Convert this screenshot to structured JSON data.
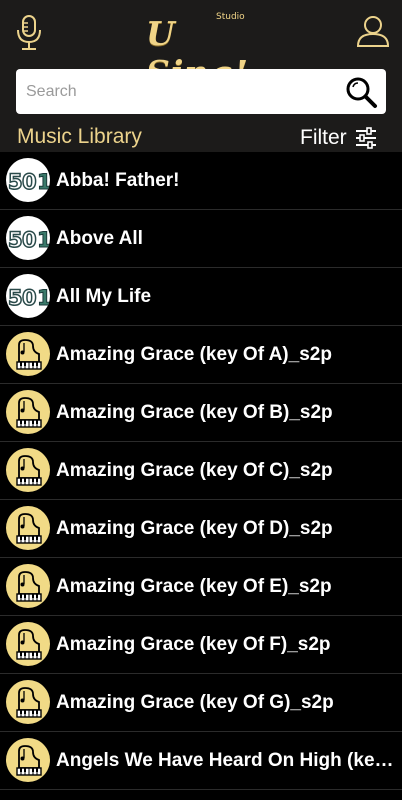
{
  "header": {
    "logo_text": "U Sing!",
    "logo_sub": "Studio",
    "colors": {
      "accent": "#ecd38c",
      "bar": "#1c1b1a",
      "background": "#000000"
    },
    "icons": [
      "microphone-icon",
      "user-icon"
    ]
  },
  "search": {
    "placeholder": "Search",
    "value": "",
    "icon": "search-icon"
  },
  "library": {
    "title": "Music Library",
    "filter_label": "Filter",
    "filter_icon": "sliders-icon"
  },
  "songs": [
    {
      "title": "Abba! Father!",
      "thumb": "501-logo"
    },
    {
      "title": "Above All",
      "thumb": "501-logo"
    },
    {
      "title": "All My Life",
      "thumb": "501-logo"
    },
    {
      "title": "Amazing Grace (key Of A)_s2p",
      "thumb": "piano-icon"
    },
    {
      "title": "Amazing Grace (key Of B)_s2p",
      "thumb": "piano-icon"
    },
    {
      "title": "Amazing Grace (key Of C)_s2p",
      "thumb": "piano-icon"
    },
    {
      "title": "Amazing Grace (key Of D)_s2p",
      "thumb": "piano-icon"
    },
    {
      "title": "Amazing Grace (key Of E)_s2p",
      "thumb": "piano-icon"
    },
    {
      "title": "Amazing Grace (key Of F)_s2p",
      "thumb": "piano-icon"
    },
    {
      "title": "Amazing Grace (key Of G)_s2p",
      "thumb": "piano-icon"
    },
    {
      "title": "Angels We Have Heard On High (key...",
      "thumb": "piano-icon"
    }
  ]
}
